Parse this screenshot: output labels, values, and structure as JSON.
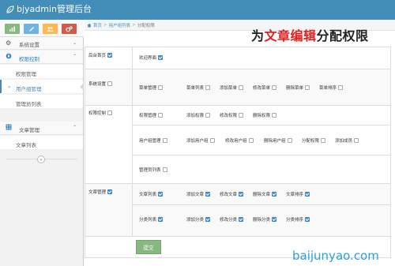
{
  "app": {
    "title": "bjyadmin管理后台"
  },
  "shortcuts": {
    "colors": [
      "#87b87f",
      "#6fb3e0",
      "#ffb752",
      "#d15b47"
    ]
  },
  "sidebar": {
    "items": [
      {
        "label": "系统设置",
        "icon": "gear-icon"
      },
      {
        "label": "权限控制",
        "icon": "lock-icon"
      },
      {
        "label": "文章管理",
        "icon": "grid-icon"
      }
    ],
    "subitems_permission": [
      {
        "label": "权限管理"
      },
      {
        "label": "用户组管理"
      },
      {
        "label": "管理员列表"
      }
    ],
    "subitems_article": [
      {
        "label": "文章列表"
      }
    ],
    "collapse_glyph": "«"
  },
  "breadcrumb": {
    "home": "首页",
    "parent": "用户组列表",
    "current": "分配权限"
  },
  "overlay": {
    "pre": "为",
    "highlight": "文章编辑",
    "post": "分配权限"
  },
  "permissions": {
    "homepage": {
      "label": "后台首页",
      "children": [
        "欢迎界面"
      ]
    },
    "system": {
      "label": "系统设置",
      "menu_label": "菜单管理",
      "children": [
        "菜单列表",
        "添加菜单",
        "修改菜单",
        "删除菜单",
        "菜单排序"
      ]
    },
    "access": {
      "label": "权限控制",
      "g1_label": "权限管理",
      "g1_children": [
        "添加权限",
        "修改权限",
        "删除权限"
      ],
      "g2_label": "用户组管理",
      "g2_children": [
        "添加用户组",
        "修改用户组",
        "删除用户组",
        "分配权限",
        "添加成员"
      ],
      "g3_label": "管理员列表"
    },
    "article": {
      "label": "文章管理",
      "g1_label": "文章列表",
      "g1_children": [
        "添加文章",
        "修改文章",
        "删除文章",
        "文章排序"
      ],
      "g2_label": "分类列表",
      "g2_children": [
        "添加分类",
        "修改分类",
        "删除分类",
        "分类排序"
      ]
    }
  },
  "submit_label": "提交",
  "watermark": "baijunyao.com"
}
